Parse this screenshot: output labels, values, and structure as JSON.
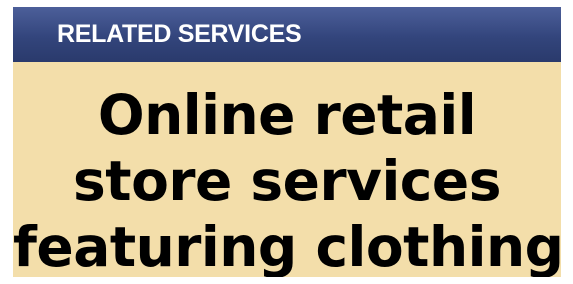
{
  "header": {
    "title": "RELATED SERVICES"
  },
  "content": {
    "lines": [
      "Online retail",
      "store services",
      "featuring clothing"
    ]
  },
  "colors": {
    "header_background": "#33457c",
    "body_background": "#f3deaa",
    "header_text": "#ffffff",
    "body_text": "#000000"
  }
}
